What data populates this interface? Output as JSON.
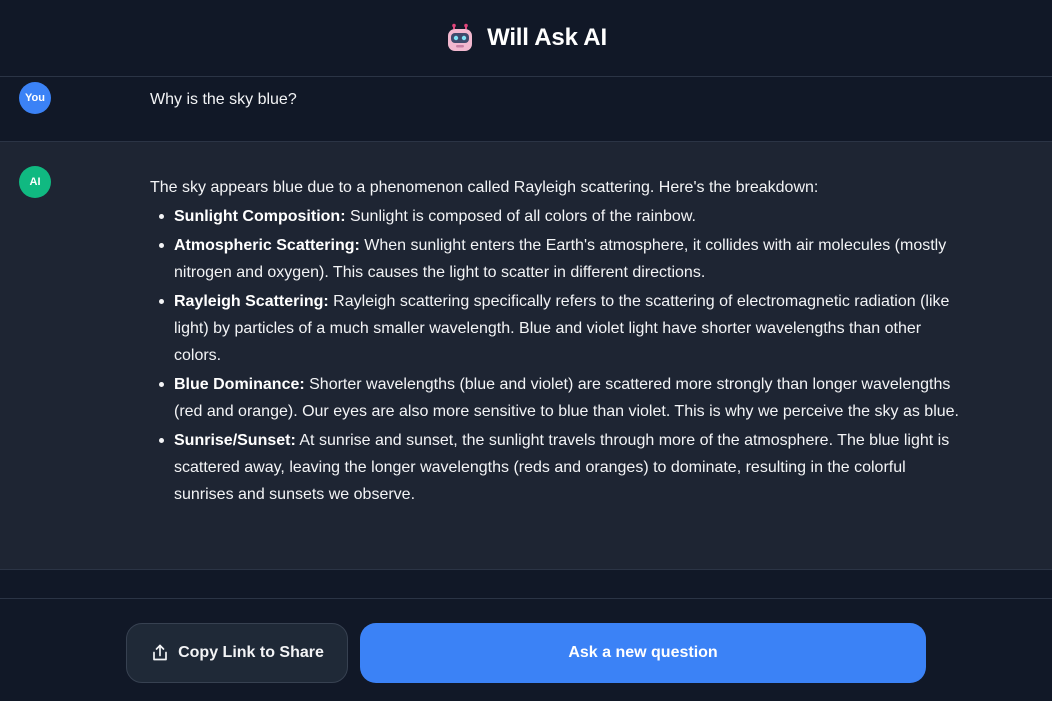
{
  "header": {
    "title": "Will Ask AI",
    "logo_icon": "robot-icon"
  },
  "conversation": {
    "user": {
      "avatar_label": "You",
      "avatar_color": "#3b82f6",
      "text": "Why is the sky blue?"
    },
    "ai": {
      "avatar_label": "AI",
      "avatar_color": "#10b981",
      "intro": "The sky appears blue due to a phenomenon called Rayleigh scattering. Here's the breakdown:",
      "points": [
        {
          "term": "Sunlight Composition:",
          "text": " Sunlight is composed of all colors of the rainbow."
        },
        {
          "term": "Atmospheric Scattering:",
          "text": " When sunlight enters the Earth's atmosphere, it collides with air molecules (mostly nitrogen and oxygen). This causes the light to scatter in different directions."
        },
        {
          "term": "Rayleigh Scattering:",
          "text": " Rayleigh scattering specifically refers to the scattering of electromagnetic radiation (like light) by particles of a much smaller wavelength. Blue and violet light have shorter wavelengths than other colors."
        },
        {
          "term": "Blue Dominance:",
          "text": " Shorter wavelengths (blue and violet) are scattered more strongly than longer wavelengths (red and orange). Our eyes are also more sensitive to blue than violet. This is why we perceive the sky as blue."
        },
        {
          "term": "Sunrise/Sunset:",
          "text": " At sunrise and sunset, the sunlight travels through more of the atmosphere. The blue light is scattered away, leaving the longer wavelengths (reds and oranges) to dominate, resulting in the colorful sunrises and sunsets we observe."
        }
      ]
    }
  },
  "footer": {
    "copy_label": "Copy Link to Share",
    "copy_icon": "share-icon",
    "ask_label": "Ask a new question",
    "accent_color": "#3b82f6"
  }
}
